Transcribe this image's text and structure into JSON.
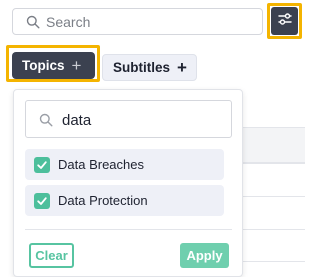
{
  "search": {
    "placeholder": "Search"
  },
  "toolbar": {
    "settings_icon": "sliders-icon"
  },
  "chips": [
    {
      "label": "Topics",
      "icon": "plus-icon",
      "active": true
    },
    {
      "label": "Subtitles",
      "icon": "plus-icon",
      "active": false
    }
  ],
  "dropdown": {
    "search_value": "data",
    "options": [
      {
        "label": "Data Breaches",
        "checked": true
      },
      {
        "label": "Data Protection",
        "checked": true
      }
    ],
    "clear_label": "Clear",
    "apply_label": "Apply"
  },
  "colors": {
    "dark": "#3b4150",
    "highlight": "#f4b400",
    "accent": "#4dbf9c"
  }
}
